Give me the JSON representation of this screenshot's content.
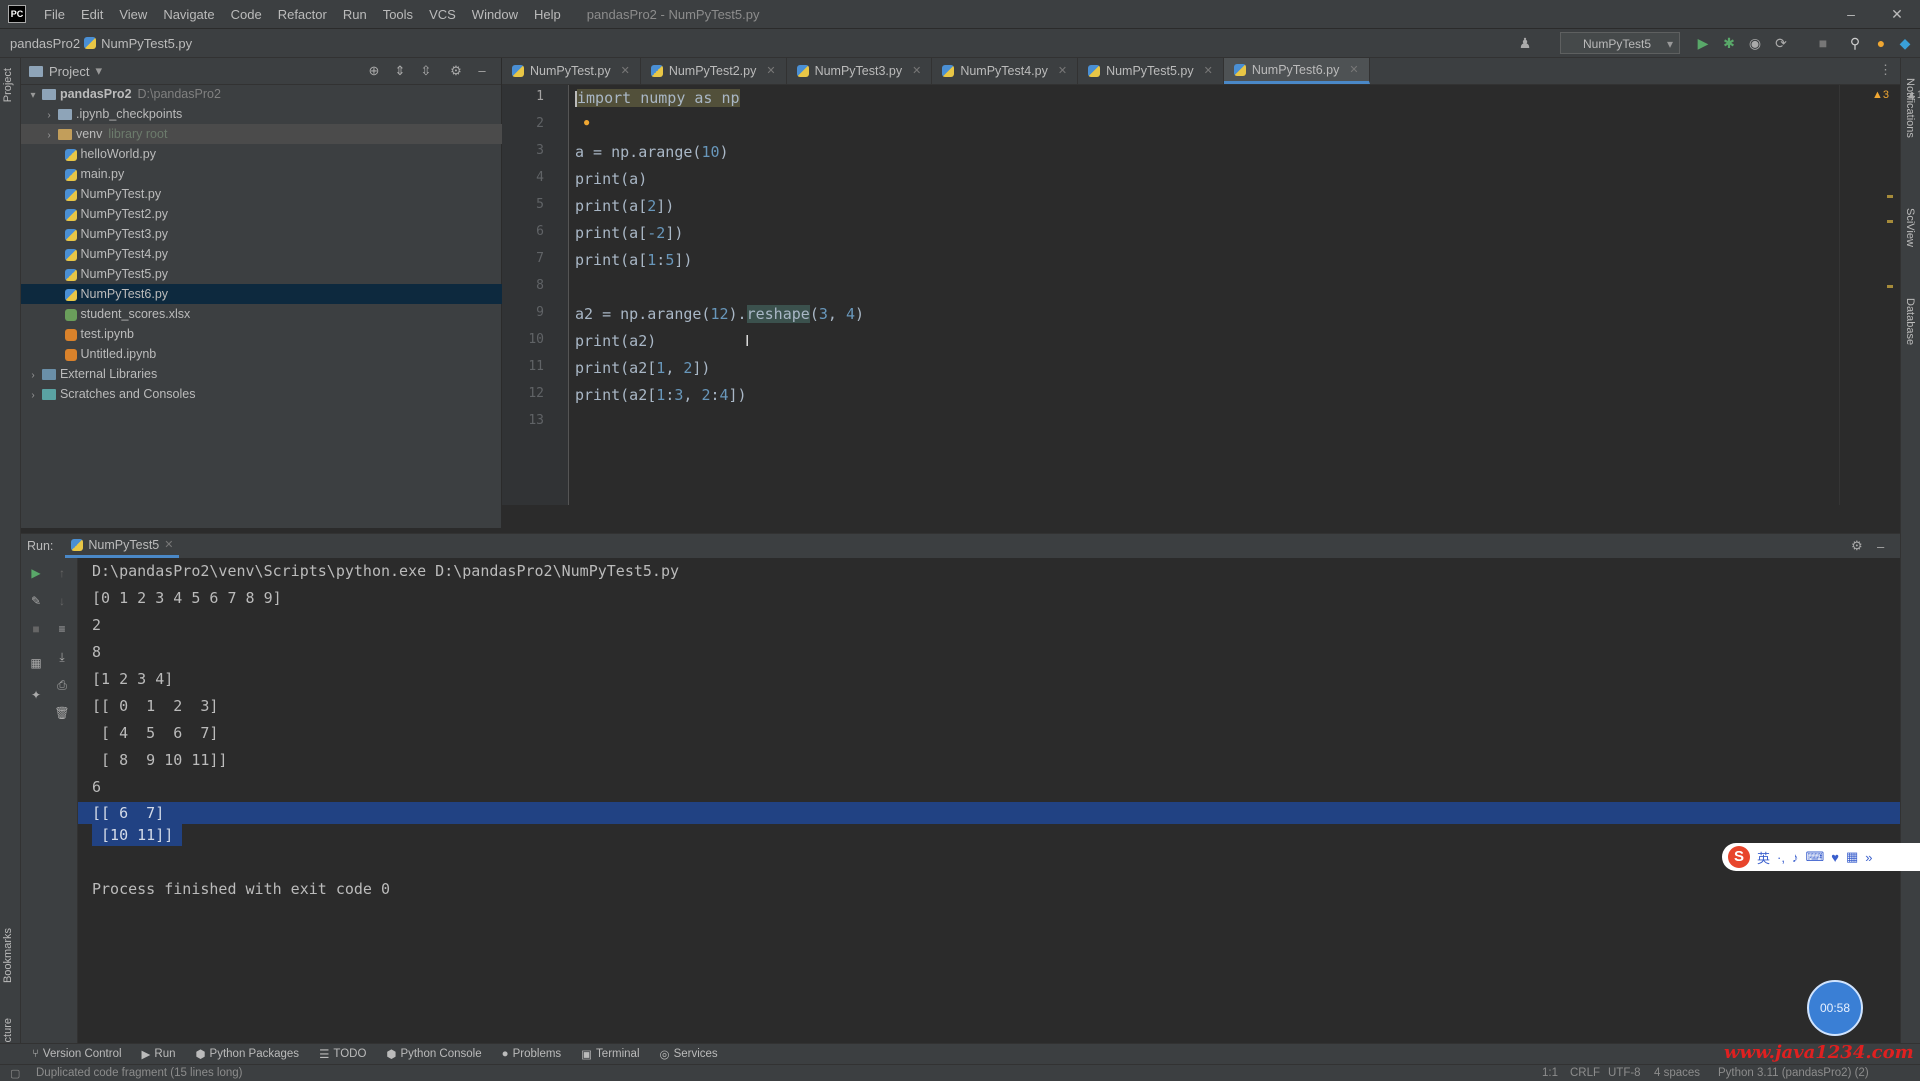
{
  "titlebar": {
    "menu": [
      "File",
      "Edit",
      "View",
      "Navigate",
      "Code",
      "Refactor",
      "Run",
      "Tools",
      "VCS",
      "Window",
      "Help"
    ],
    "window_title": "pandasPro2 - NumPyTest5.py"
  },
  "navbar": {
    "project": "pandasPro2",
    "file": "NumPyTest5.py",
    "run_config": "NumPyTest5"
  },
  "project_panel": {
    "title": "Project",
    "tree": [
      {
        "label": "pandasPro2",
        "hint": "D:\\pandasPro2",
        "kind": "root"
      },
      {
        "label": ".ipynb_checkpoints",
        "hint": "",
        "kind": "folder"
      },
      {
        "label": "venv",
        "hint": "library root",
        "kind": "folder"
      },
      {
        "label": "helloWorld.py",
        "hint": "",
        "kind": "py"
      },
      {
        "label": "main.py",
        "hint": "",
        "kind": "py"
      },
      {
        "label": "NumPyTest.py",
        "hint": "",
        "kind": "py"
      },
      {
        "label": "NumPyTest2.py",
        "hint": "",
        "kind": "py"
      },
      {
        "label": "NumPyTest3.py",
        "hint": "",
        "kind": "py"
      },
      {
        "label": "NumPyTest4.py",
        "hint": "",
        "kind": "py"
      },
      {
        "label": "NumPyTest5.py",
        "hint": "",
        "kind": "py"
      },
      {
        "label": "NumPyTest6.py",
        "hint": "",
        "kind": "py"
      },
      {
        "label": "student_scores.xlsx",
        "hint": "",
        "kind": "xlsx"
      },
      {
        "label": "test.ipynb",
        "hint": "",
        "kind": "ipynb"
      },
      {
        "label": "Untitled.ipynb",
        "hint": "",
        "kind": "ipynb"
      },
      {
        "label": "External Libraries",
        "hint": "",
        "kind": "lib"
      },
      {
        "label": "Scratches and Consoles",
        "hint": "",
        "kind": "scratch"
      }
    ]
  },
  "tabs": [
    "NumPyTest.py",
    "NumPyTest2.py",
    "NumPyTest3.py",
    "NumPyTest4.py",
    "NumPyTest5.py",
    "NumPyTest6.py"
  ],
  "editor": {
    "line_numbers": [
      "1",
      "2",
      "3",
      "4",
      "5",
      "6",
      "7",
      "8",
      "9",
      "10",
      "11",
      "12",
      "13"
    ],
    "inspection": {
      "warnings": "3",
      "weak_warnings": "1"
    },
    "code": {
      "l1_kw1": "import",
      "l1_mod": " numpy ",
      "l1_kw2": "as",
      "l1_alias": " np",
      "l3_pre": "a = np.arange(",
      "l3_num": "10",
      "l3_post": ")",
      "l4": "print(a)",
      "l5_pre": "print(a[",
      "l5_num": "2",
      "l5_post": "])",
      "l6_pre": "print(a[",
      "l6_num": "-2",
      "l6_post": "])",
      "l7_pre": "print(a[",
      "l7_n1": "1",
      "l7_mid": ":",
      "l7_n2": "5",
      "l7_post": "])",
      "l9_pre": "a2 = np.arange(",
      "l9_n1": "12",
      "l9_mid": ").",
      "l9_method": "reshape",
      "l9_open": "(",
      "l9_n2": "3",
      "l9_comma": ", ",
      "l9_n3": "4",
      "l9_post": ")",
      "l10": "print(a2)",
      "l11_pre": "print(a2[",
      "l11_n1": "1",
      "l11_mid": ", ",
      "l11_n2": "2",
      "l11_post": "])",
      "l12_pre": "print(a2[",
      "l12_n1": "1",
      "l12_c1": ":",
      "l12_n2": "3",
      "l12_mid": ", ",
      "l12_n3": "2",
      "l12_c2": ":",
      "l12_n4": "4",
      "l12_post": "])"
    }
  },
  "run_panel": {
    "label": "Run:",
    "tab": "NumPyTest5",
    "output": [
      "D:\\pandasPro2\\venv\\Scripts\\python.exe D:\\pandasPro2\\NumPyTest5.py",
      "[0 1 2 3 4 5 6 7 8 9]",
      "2",
      "8",
      "[1 2 3 4]",
      "[[ 0  1  2  3]",
      " [ 4  5  6  7]",
      " [ 8  9 10 11]]",
      "6",
      "[[ 6  7]",
      " [10 11]]",
      "",
      "Process finished with exit code 0"
    ]
  },
  "bottom_tools": [
    "Version Control",
    "Run",
    "Python Packages",
    "TODO",
    "Python Console",
    "Problems",
    "Terminal",
    "Services"
  ],
  "statusbar": {
    "message": "Duplicated code fragment (15 lines long)",
    "position": "1:1",
    "line_sep": "CRLF",
    "encoding": "UTF-8",
    "indent": "4 spaces",
    "interpreter": "Python 3.11 (pandasPro2) (2)"
  },
  "overlay": {
    "ime_glyph": "S",
    "ime_lang": "英",
    "timer": "00:58",
    "watermark": "www.java1234.com"
  },
  "colors": {
    "background": "#2b2b2b",
    "panel": "#3c3f41",
    "keyword": "#cc7832",
    "number": "#6897bb",
    "selection": "#214283",
    "tree_selected": "#0d293e"
  }
}
